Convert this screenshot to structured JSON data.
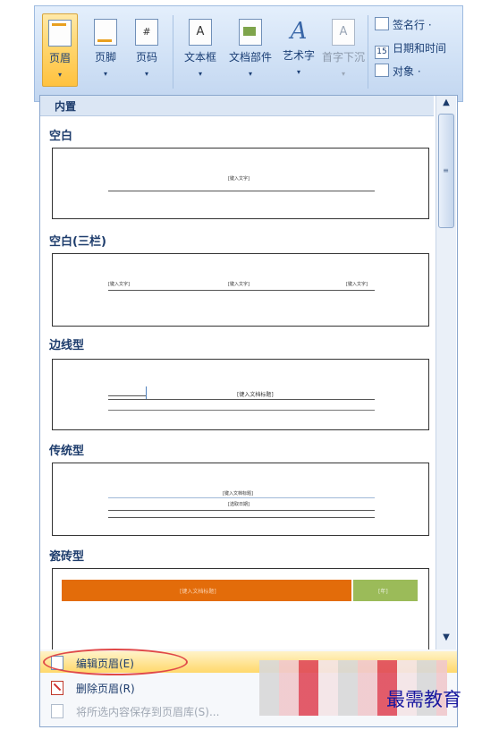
{
  "ribbon": {
    "buttons": [
      {
        "label": "页眉",
        "icon": "header-icon",
        "active": true
      },
      {
        "label": "页脚",
        "icon": "footer-icon"
      },
      {
        "label": "页码",
        "icon": "page-number-icon",
        "glyph": "#"
      },
      {
        "label": "文本框",
        "icon": "text-box-icon",
        "glyph": "A"
      },
      {
        "label": "文档部件",
        "icon": "quick-parts-icon"
      },
      {
        "label": "艺术字",
        "icon": "wordart-icon",
        "glyph": "A"
      },
      {
        "label": "首字下沉",
        "icon": "drop-cap-icon",
        "disabled": true
      }
    ],
    "small": [
      {
        "label": "签名行 ·",
        "icon": "signature-line-icon"
      },
      {
        "label": "日期和时间",
        "icon": "date-time-icon",
        "glyph": "15"
      },
      {
        "label": "对象 ·",
        "icon": "object-icon"
      }
    ]
  },
  "gallery": {
    "section": "内置",
    "items": [
      {
        "title": "空白",
        "placeholders": [
          "[键入文字]"
        ]
      },
      {
        "title": "空白(三栏)",
        "placeholders": [
          "[键入文字]",
          "[键入文字]",
          "[键入文字]"
        ]
      },
      {
        "title": "边线型",
        "placeholders": [
          "[键入文档标题]"
        ]
      },
      {
        "title": "传统型",
        "placeholders": [
          "[键入文档标题]",
          "[选取日期]"
        ]
      },
      {
        "title": "瓷砖型",
        "placeholders": [
          "[键入文档标题]",
          "[年]"
        ]
      }
    ]
  },
  "menu": [
    {
      "label": "编辑页眉(E)",
      "icon": "edit-header-icon"
    },
    {
      "label": "删除页眉(R)",
      "icon": "remove-header-icon"
    },
    {
      "label": "将所选内容保存到页眉库(S)...",
      "icon": "save-to-gallery-icon"
    }
  ],
  "watermark": "最需教育",
  "colors": {
    "tile_orange": "#e36c0a",
    "tile_green": "#9bbb59",
    "highlight": "#ffd86b"
  }
}
